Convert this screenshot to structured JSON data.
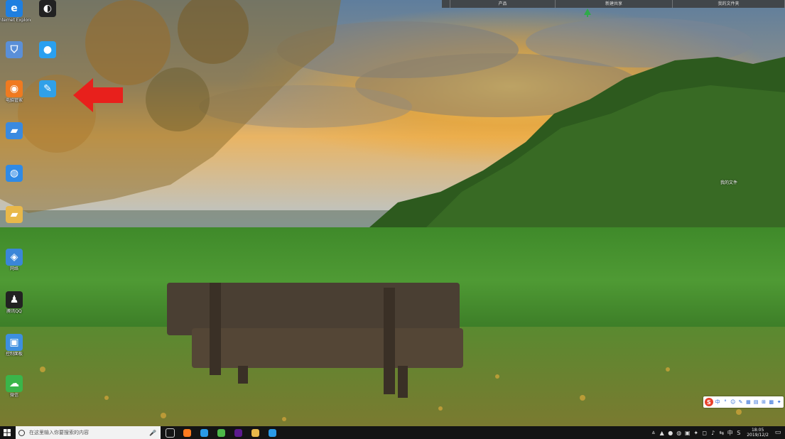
{
  "top_strip": {
    "tabs": [
      {
        "label": "",
        "width": 12
      },
      {
        "label": "产品",
        "width": 148
      },
      {
        "label": "新建共享",
        "width": 165
      },
      {
        "label": "我的文件夹",
        "width": 158
      }
    ]
  },
  "desktop_icons": [
    {
      "label": "Internet Explorer",
      "icon": "ie-icon",
      "color": "#1f7fe0",
      "glyph": "e",
      "col": 0,
      "row": 0
    },
    {
      "label": "",
      "icon": "obs-icon",
      "color": "#222222",
      "glyph": "◐",
      "col": 1,
      "row": 0
    },
    {
      "label": "",
      "icon": "shield-icon",
      "color": "#5a8fd8",
      "glyph": "⛉",
      "col": 0,
      "row": 1
    },
    {
      "label": "",
      "icon": "message-icon",
      "color": "#2aa0f0",
      "glyph": "●",
      "col": 1,
      "row": 1
    },
    {
      "label": "电脑管家",
      "icon": "tencent-manager-icon",
      "color": "#f07a20",
      "glyph": "◉",
      "col": 0,
      "row": 2
    },
    {
      "label": "",
      "icon": "feather-icon",
      "color": "#30a0e8",
      "glyph": "✎",
      "col": 1,
      "row": 2
    },
    {
      "label": "",
      "icon": "folder-blue-icon",
      "color": "#3a8ae0",
      "glyph": "▰",
      "col": 0,
      "row": 3
    },
    {
      "label": "",
      "icon": "globe-icon",
      "color": "#2f8ae6",
      "glyph": "◍",
      "col": 0,
      "row": 4
    },
    {
      "label": "",
      "icon": "folder-icon",
      "color": "#e8b84a",
      "glyph": "▰",
      "col": 0,
      "row": 5
    },
    {
      "label": "网络",
      "icon": "network-icon",
      "color": "#3b86d8",
      "glyph": "◈",
      "col": 0,
      "row": 6
    },
    {
      "label": "腾讯QQ",
      "icon": "qq-icon",
      "color": "#222222",
      "glyph": "♟",
      "col": 0,
      "row": 7
    },
    {
      "label": "控制面板",
      "icon": "control-panel-icon",
      "color": "#3d8fe0",
      "glyph": "▣",
      "col": 0,
      "row": 8
    },
    {
      "label": "微信",
      "icon": "wechat-icon",
      "color": "#3ab54a",
      "glyph": "☁",
      "col": 0,
      "row": 9
    }
  ],
  "right_label": "我的文件",
  "ime": {
    "logo": "S",
    "items": [
      "中",
      "°",
      "☺",
      "✎",
      "▦",
      "▤",
      "⊞",
      "▩",
      "✦"
    ]
  },
  "taskbar": {
    "search_placeholder": "在这里输入你要搜索的内容",
    "mic_glyph": "🎤",
    "apps": [
      {
        "name": "task-view-icon",
        "color": "#1a1a1a"
      },
      {
        "name": "firefox-icon",
        "color": "#ff7b1f"
      },
      {
        "name": "browser-icon",
        "color": "#2a9ae8"
      },
      {
        "name": "360-icon",
        "color": "#4cb848"
      },
      {
        "name": "premiere-icon",
        "color": "#5c1a8e"
      },
      {
        "name": "file-explorer-icon",
        "color": "#e8b84a"
      },
      {
        "name": "writer-app-icon",
        "color": "#2a9ae8"
      }
    ],
    "tray_icons": [
      "⩓",
      "▲",
      "●",
      "◍",
      "▣",
      "✦",
      "◻",
      "♪",
      "⇆",
      "中",
      "S"
    ],
    "time": "18:05",
    "date": "2019/12/2",
    "notification_glyph": "▭"
  },
  "colors": {
    "sky_top": "#6d8aa8",
    "sunset": "#f0a52a",
    "field": "#4f9a34",
    "taskbar": "#141414"
  }
}
